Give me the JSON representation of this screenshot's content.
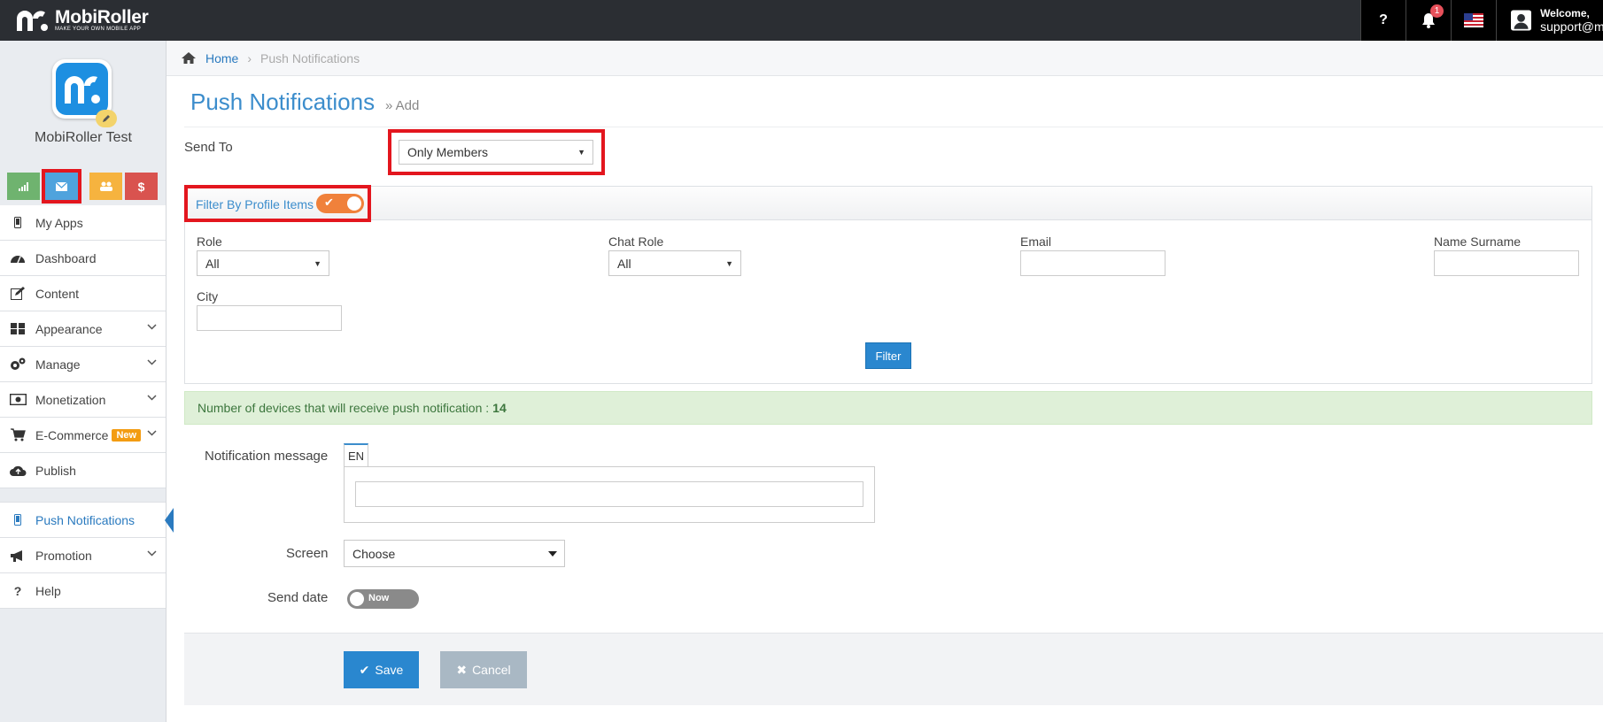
{
  "topbar": {
    "logo_name": "MobiRoller",
    "logo_tagline": "MAKE YOUR OWN MOBILE APP",
    "help_label": "?",
    "notification_count": "1",
    "welcome_label": "Welcome,",
    "user_email": "support@m"
  },
  "sidebar": {
    "app_name": "MobiRoller Test",
    "quick_actions": {
      "monetize_symbol": "$"
    },
    "items": [
      {
        "label": "My Apps",
        "icon": "phone-icon"
      },
      {
        "label": "Dashboard",
        "icon": "dashboard-icon"
      },
      {
        "label": "Content",
        "icon": "edit-icon"
      },
      {
        "label": "Appearance",
        "icon": "grid-icon"
      },
      {
        "label": "Manage",
        "icon": "gears-icon"
      },
      {
        "label": "Monetization",
        "icon": "money-icon"
      },
      {
        "label": "E-Commerce",
        "icon": "cart-icon",
        "badge": "New"
      },
      {
        "label": "Publish",
        "icon": "cloud-upload-icon"
      }
    ],
    "items2": [
      {
        "label": "Push Notifications",
        "icon": "phone-icon"
      },
      {
        "label": "Promotion",
        "icon": "megaphone-icon"
      },
      {
        "label": "Help",
        "icon": "question-icon"
      }
    ]
  },
  "breadcrumb": {
    "home": "Home",
    "current": "Push Notifications"
  },
  "page": {
    "title": "Push Notifications",
    "subtitle": "» Add"
  },
  "form": {
    "send_to_label": "Send To",
    "send_to_value": "Only Members",
    "filter_title": "Filter By Profile Items",
    "role_label": "Role",
    "role_value": "All",
    "chat_role_label": "Chat Role",
    "chat_role_value": "All",
    "email_label": "Email",
    "name_label": "Name Surname",
    "city_label": "City",
    "filter_button": "Filter",
    "devices_text": "Number of devices that will receive push notification :",
    "devices_count": "14",
    "message_label": "Notification message",
    "lang_tab": "EN",
    "screen_label": "Screen",
    "screen_value": "Choose",
    "send_date_label": "Send date",
    "send_date_toggle": "Now",
    "save_label": "Save",
    "cancel_label": "Cancel"
  },
  "colors": {
    "accent": "#2a87cf",
    "highlight": "#e3161e",
    "toggle_on": "#f0813b"
  }
}
